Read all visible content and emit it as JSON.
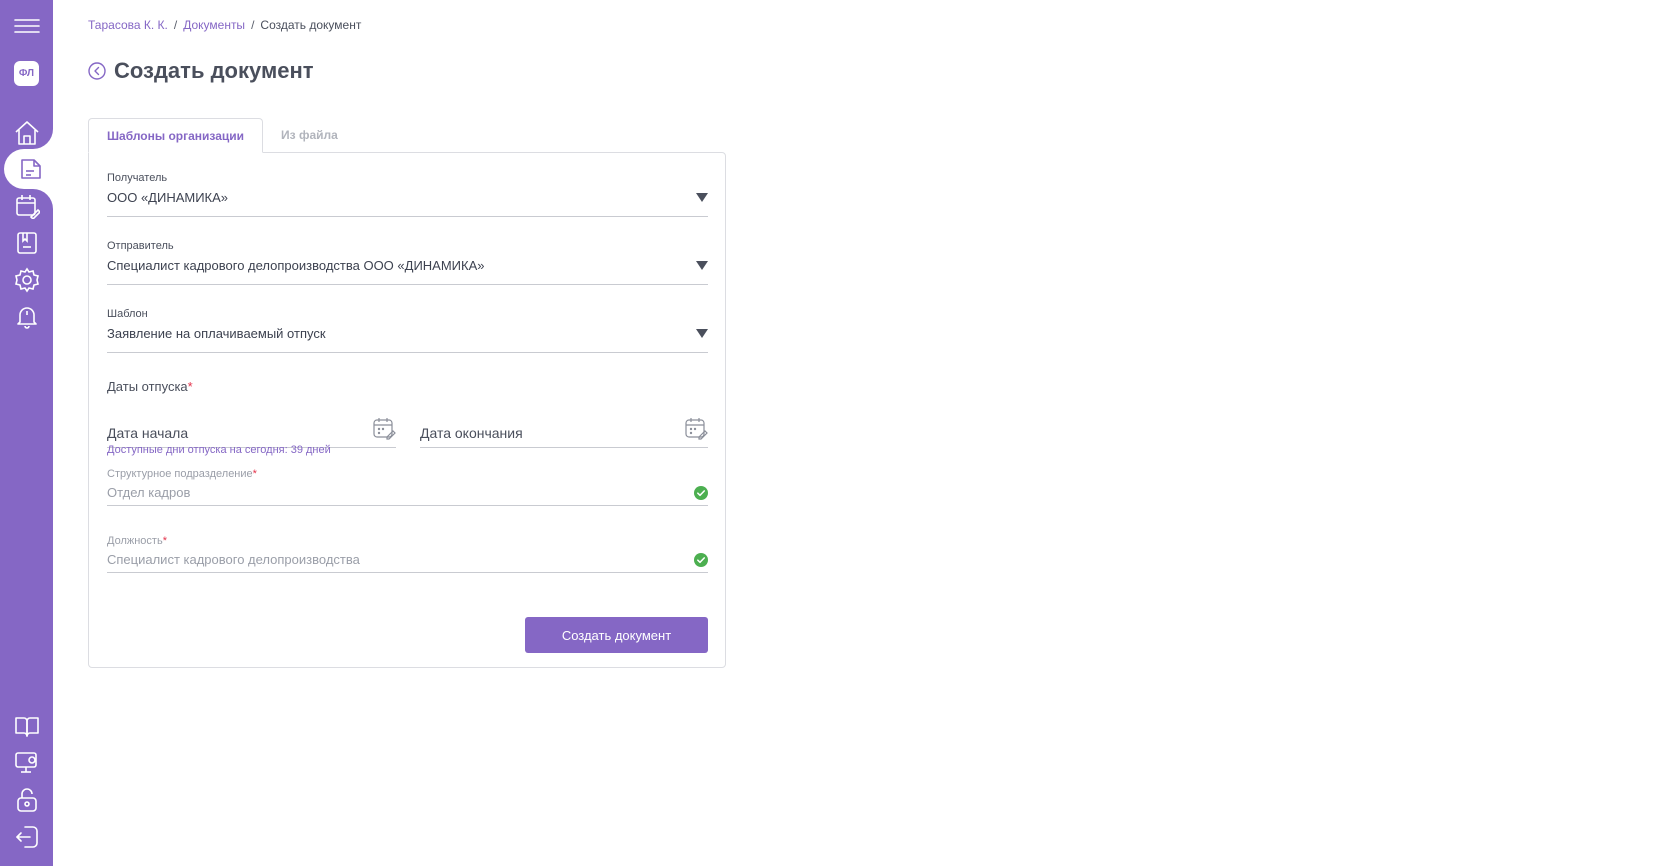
{
  "sidebar": {
    "avatar_text": "ФЛ",
    "accent": "#8567c5",
    "items": [
      {
        "icon": "home-icon"
      },
      {
        "icon": "document-icon",
        "active": true
      },
      {
        "icon": "calendar-edit-icon"
      },
      {
        "icon": "archive-icon"
      },
      {
        "icon": "gear-icon"
      },
      {
        "icon": "bell-icon"
      },
      {
        "icon": "book-icon"
      },
      {
        "icon": "monitor-icon"
      },
      {
        "icon": "unlock-icon"
      },
      {
        "icon": "logout-icon"
      }
    ]
  },
  "breadcrumb": {
    "user": "Тарасова К. К.",
    "documents": "Документы",
    "current": "Создать документ",
    "separator": "/"
  },
  "page": {
    "title": "Создать документ"
  },
  "tabs": {
    "org_templates": "Шаблоны организации",
    "from_file": "Из файла"
  },
  "form": {
    "recipient": {
      "label": "Получатель",
      "value": "ООО «ДИНАМИКА»"
    },
    "sender": {
      "label": "Отправитель",
      "value": "Специалист кадрового делопроизводства ООО «ДИНАМИКА»"
    },
    "template": {
      "label": "Шаблон",
      "value": "Заявление на оплачиваемый отпуск"
    },
    "vacation_dates": {
      "label": "Даты отпуска",
      "required_mark": "*",
      "start_placeholder": "Дата начала",
      "end_placeholder": "Дата окончания",
      "hint": "Доступные дни отпуска на сегодня: 39 дней"
    },
    "department": {
      "label": "Структурное подразделение",
      "required_mark": "*",
      "value": "Отдел кадров"
    },
    "position": {
      "label": "Должность",
      "required_mark": "*",
      "value": "Специалист кадрового делопроизводства"
    },
    "submit_label": "Создать документ"
  }
}
